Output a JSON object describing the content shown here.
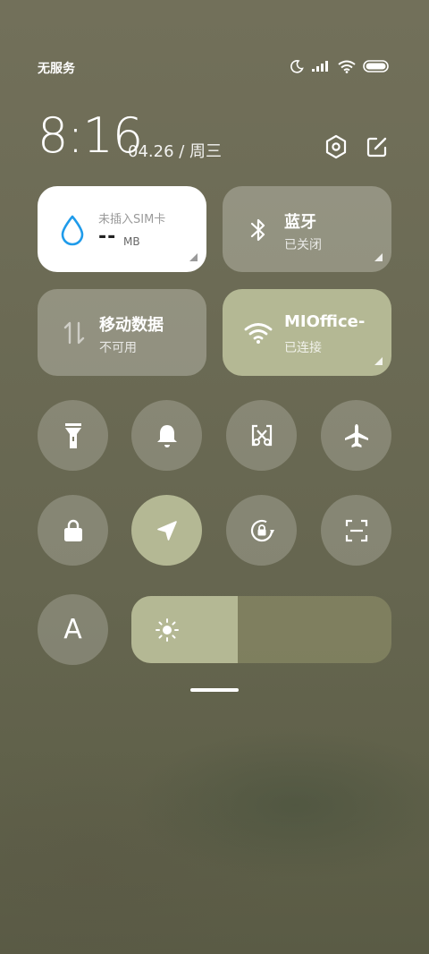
{
  "status_bar": {
    "carrier": "无服务",
    "icons": [
      "moon-icon",
      "signal-icon",
      "wifi-icon",
      "battery-icon"
    ]
  },
  "header": {
    "time": "8:16",
    "date": "04.26 / 周三",
    "buttons": [
      "settings-icon",
      "edit-icon"
    ]
  },
  "tiles": {
    "data_usage": {
      "label": "未插入SIM卡",
      "value": "--",
      "unit": "MB",
      "icon": "water-drop-icon"
    },
    "bluetooth": {
      "title": "蓝牙",
      "status": "已关闭",
      "icon": "bluetooth-icon"
    },
    "mobile_data": {
      "title": "移动数据",
      "status": "不可用",
      "icon": "data-arrows-icon"
    },
    "wifi": {
      "title": "MIOffice-",
      "status": "已连接",
      "icon": "wifi-icon"
    }
  },
  "toggles_row1": [
    "flashlight-icon",
    "bell-icon",
    "screenshot-icon",
    "airplane-icon"
  ],
  "toggles_row2": [
    "lock-icon",
    "location-icon",
    "rotation-lock-icon",
    "scan-icon"
  ],
  "auto_brightness": {
    "label": "A"
  },
  "brightness": {
    "level_percent": 41,
    "icon": "sun-icon"
  },
  "colors": {
    "accent": "#b4b894",
    "drop_blue": "#1f9bea"
  }
}
